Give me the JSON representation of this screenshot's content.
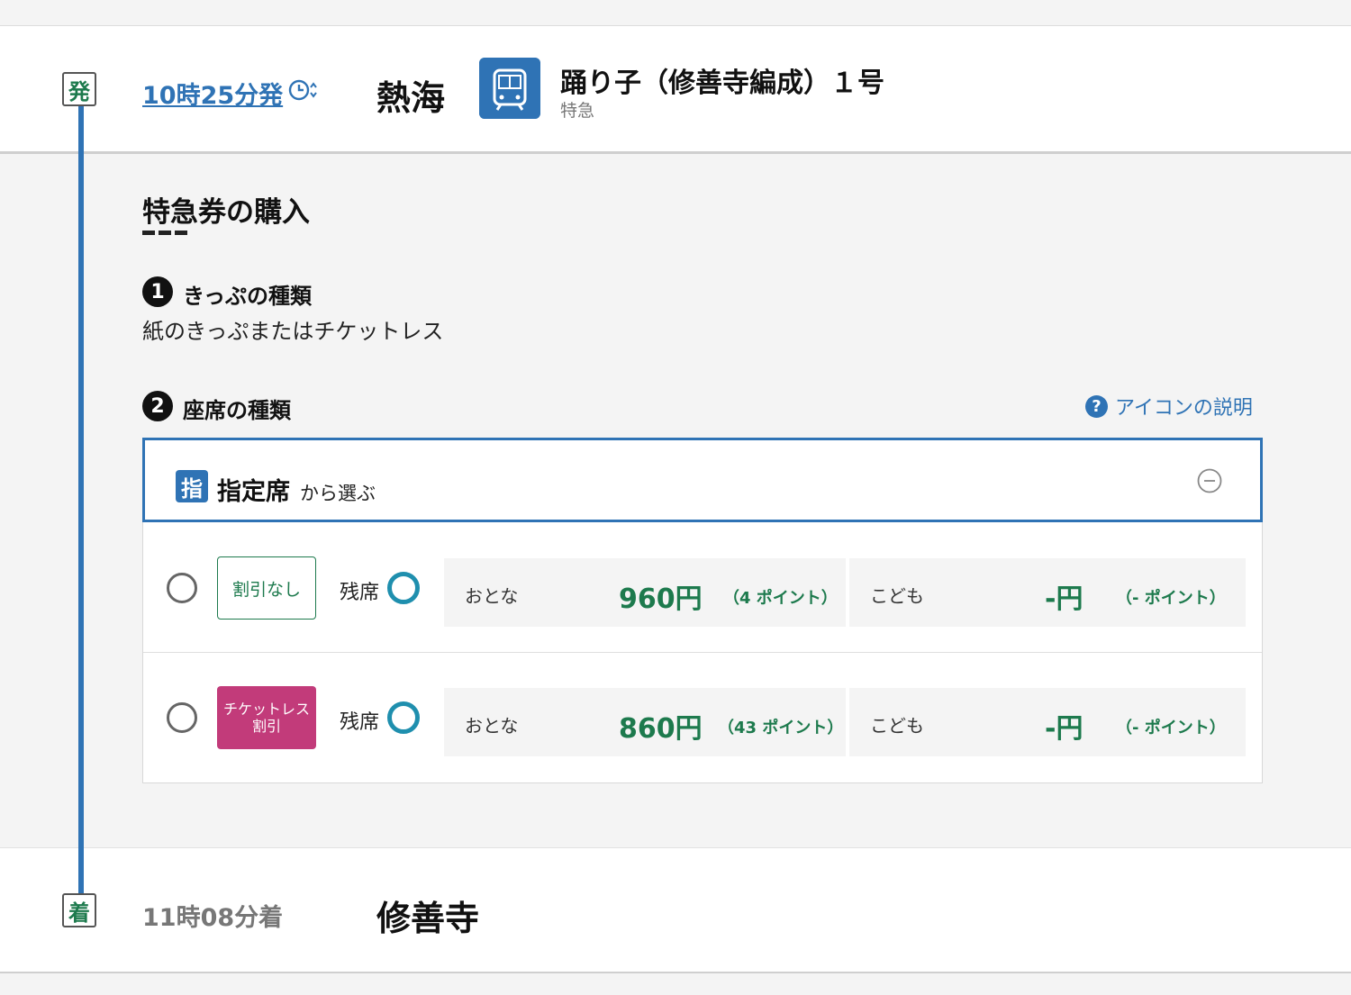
{
  "departure": {
    "badge": "発",
    "time": "10時25分発",
    "station": "熱海"
  },
  "train": {
    "icon": "train-icon",
    "name": "踊り子（修善寺編成）１号",
    "type": "特急"
  },
  "section": {
    "title": "特急券の購入"
  },
  "steps": [
    {
      "number": "1",
      "label": "きっぷの種類",
      "value": "紙のきっぷまたはチケットレス"
    },
    {
      "number": "2",
      "label": "座席の種類"
    }
  ],
  "help": {
    "icon": "question-icon",
    "label": "アイコンの説明"
  },
  "seat_class": {
    "badge": "指",
    "label": "指定席",
    "suffix": "から選ぶ"
  },
  "options": [
    {
      "discount": "割引なし",
      "availability_label": "残席",
      "adult_label": "おとな",
      "adult_price": "960円",
      "adult_points": "（4 ポイント）",
      "child_label": "こども",
      "child_price": "-円",
      "child_points": "（- ポイント）"
    },
    {
      "discount_line1": "チケットレス",
      "discount_line2": "割引",
      "availability_label": "残席",
      "adult_label": "おとな",
      "adult_price": "860円",
      "adult_points": "（43 ポイント）",
      "child_label": "こども",
      "child_price": "-円",
      "child_points": "（- ポイント）"
    }
  ],
  "arrival": {
    "badge": "着",
    "time": "11時08分着",
    "station": "修善寺"
  },
  "colors": {
    "accent": "#2f73b5",
    "price_green": "#1d7a4d",
    "ticketless_pink": "#c23b7a",
    "availability": "#1f8fae"
  }
}
